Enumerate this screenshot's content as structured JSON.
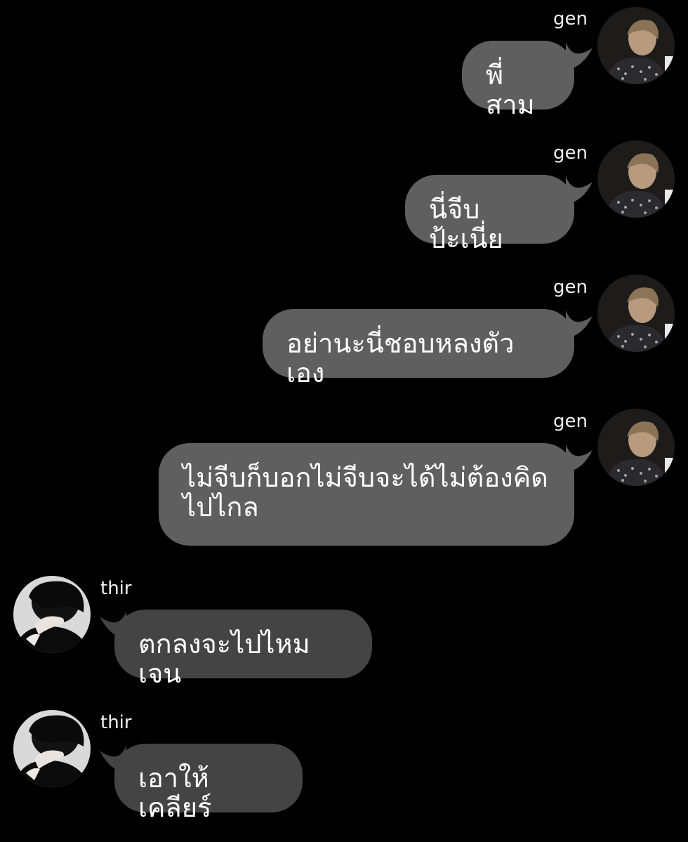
{
  "chat": {
    "messages": [
      {
        "sender": "gen",
        "side": "right",
        "text": "พี่สาม",
        "avatar": "gen-avatar"
      },
      {
        "sender": "gen",
        "side": "right",
        "text": "นี่จีบป้ะเนี่ย",
        "avatar": "gen-avatar"
      },
      {
        "sender": "gen",
        "side": "right",
        "text": "อย่านะนี่ชอบหลงตัวเอง",
        "avatar": "gen-avatar"
      },
      {
        "sender": "gen",
        "side": "right",
        "text": "ไม่จีบก็บอกไม่จีบจะได้ไม่ต้องคิด\nไปไกล",
        "avatar": "gen-avatar"
      },
      {
        "sender": "thir",
        "side": "left",
        "text": "ตกลงจะไปไหมเจน",
        "avatar": "thir-avatar"
      },
      {
        "sender": "thir",
        "side": "left",
        "text": "เอาให้เคลียร์",
        "avatar": "thir-avatar"
      }
    ]
  },
  "colors": {
    "background": "#000000",
    "bubble_right": "#5f5f5f",
    "bubble_left": "#444444",
    "text": "#ffffff"
  }
}
